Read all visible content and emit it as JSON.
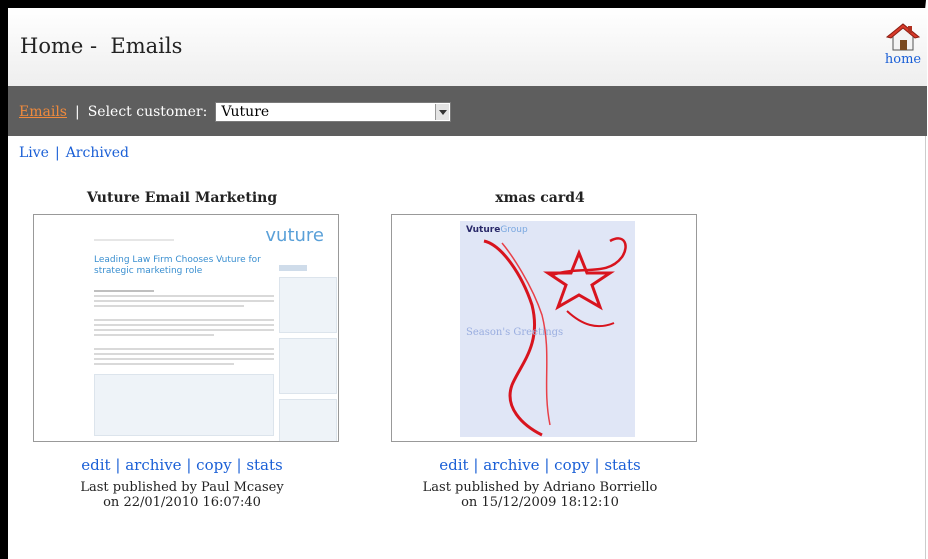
{
  "page": {
    "title": "Home -  Emails"
  },
  "home_link": {
    "label": "home"
  },
  "toolbar": {
    "emails_label": "Emails",
    "separator": "|",
    "select_customer_label": "Select customer:",
    "customer_selected": "Vuture"
  },
  "subnav": {
    "live_label": "Live",
    "separator": "|",
    "archived_label": "Archived"
  },
  "cards": [
    {
      "title": "Vuture Email Marketing",
      "actions": {
        "edit": "edit",
        "archive": "archive",
        "copy": "copy",
        "stats": "stats",
        "sep": "|"
      },
      "published_by": "Last published by Paul Mcasey",
      "published_on": "on 22/01/2010 16:07:40",
      "thumbnail": {
        "logo": "vuture",
        "headline": "Leading Law Firm Chooses Vuture for strategic marketing role"
      }
    },
    {
      "title": "xmas card4",
      "actions": {
        "edit": "edit",
        "archive": "archive",
        "copy": "copy",
        "stats": "stats",
        "sep": "|"
      },
      "published_by": "Last published by Adriano Borriello",
      "published_on": "on 15/12/2009 18:12:10",
      "thumbnail": {
        "logo_bold": "Vuture",
        "logo_light": "Group",
        "greeting": "Season's Greetings"
      }
    }
  ],
  "colors": {
    "toolbar_bg": "#5e5e5e",
    "link": "#1a5fd6",
    "active_tab": "#f08a3c"
  }
}
